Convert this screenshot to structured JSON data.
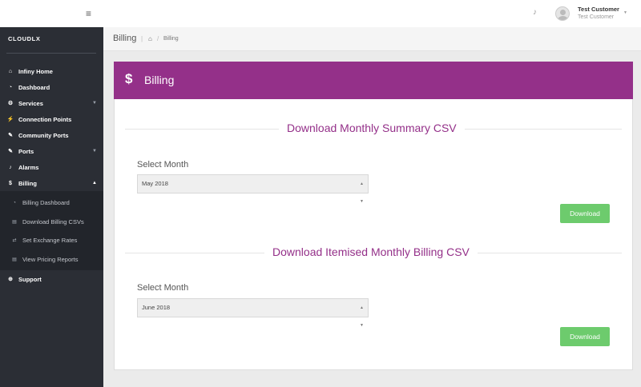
{
  "brand": {
    "name": "CLOUDLX"
  },
  "sidebar": {
    "items": [
      {
        "label": "Infiny Home",
        "icon": "home-icon",
        "glyph": "⌂"
      },
      {
        "label": "Dashboard",
        "icon": "dashboard-icon",
        "glyph": "◔"
      },
      {
        "label": "Services",
        "icon": "cogs-icon",
        "glyph": "⚙"
      },
      {
        "label": "Connection Points",
        "icon": "bolt-icon",
        "glyph": "⚡"
      },
      {
        "label": "Community Ports",
        "icon": "plug-icon",
        "glyph": "✎"
      },
      {
        "label": "Ports",
        "icon": "plug-icon",
        "glyph": "✎"
      },
      {
        "label": "Alarms",
        "icon": "bell-icon",
        "glyph": "♪"
      },
      {
        "label": "Billing",
        "icon": "dollar-icon",
        "glyph": "$"
      }
    ],
    "billing_sub": [
      {
        "label": "Billing Dashboard",
        "icon": "dashboard-icon",
        "glyph": "◔"
      },
      {
        "label": "Download Billing CSVs",
        "icon": "file-icon",
        "glyph": "▤"
      },
      {
        "label": "Set Exchange Rates",
        "icon": "exchange-icon",
        "glyph": "⇄"
      },
      {
        "label": "View Pricing Reports",
        "icon": "file-icon",
        "glyph": "▤"
      }
    ],
    "support": {
      "label": "Support",
      "icon": "lifebuoy-icon",
      "glyph": "⊕"
    }
  },
  "topbar": {
    "user_name": "Test Customer",
    "user_sub": "Test Customer"
  },
  "breadcrumb": {
    "title": "Billing",
    "current": "Billing"
  },
  "card": {
    "title": "Billing",
    "section1": {
      "title": "Download Monthly Summary CSV",
      "label": "Select Month",
      "selected": "May 2018",
      "button": "Download"
    },
    "section2": {
      "title": "Download Itemised Monthly Billing CSV",
      "label": "Select Month",
      "selected": "June 2018",
      "button": "Download"
    }
  },
  "colors": {
    "accent": "#943089",
    "sidebar": "#2b2e35",
    "button": "#6dcb6d"
  }
}
